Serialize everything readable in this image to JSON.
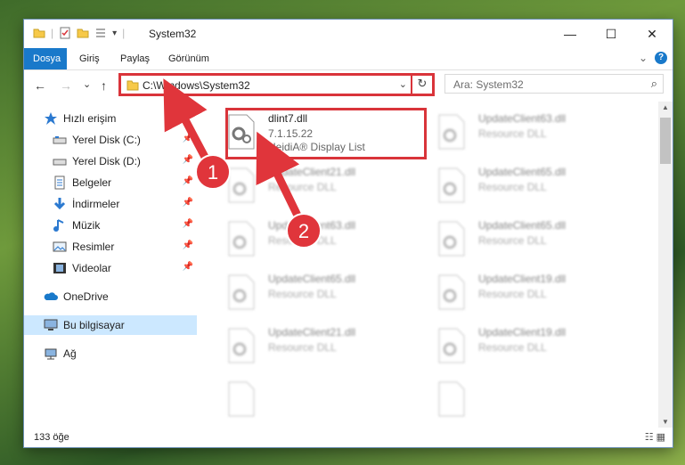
{
  "window": {
    "title": "System32",
    "min_glyph": "—",
    "max_glyph": "☐",
    "close_glyph": "✕"
  },
  "ribbon": {
    "tabs": [
      "Dosya",
      "Giriş",
      "Paylaş",
      "Görünüm"
    ],
    "expand_glyph": "⌄",
    "help_glyph": "?"
  },
  "nav": {
    "back": "←",
    "forward": "→",
    "recent": "⌄",
    "up": "↑",
    "address": "C:\\Windows\\System32",
    "dropdown": "⌄",
    "refresh": "↻",
    "search_placeholder": "Ara: System32",
    "search_icon": "⌕"
  },
  "sidebar": {
    "items": [
      {
        "label": "Hızlı erişim",
        "icon": "star-icon"
      },
      {
        "label": "Yerel Disk (C:)",
        "icon": "drive-icon",
        "pinned": true
      },
      {
        "label": "Yerel Disk (D:)",
        "icon": "drive-icon",
        "pinned": true
      },
      {
        "label": "Belgeler",
        "icon": "documents-icon",
        "pinned": true
      },
      {
        "label": "İndirmeler",
        "icon": "downloads-icon",
        "pinned": true
      },
      {
        "label": "Müzik",
        "icon": "music-icon",
        "pinned": true
      },
      {
        "label": "Resimler",
        "icon": "pictures-icon",
        "pinned": true
      },
      {
        "label": "Videolar",
        "icon": "videos-icon",
        "pinned": true
      },
      {
        "label": "OneDrive",
        "icon": "cloud-icon"
      },
      {
        "label": "Bu bilgisayar",
        "icon": "computer-icon",
        "selected": true
      },
      {
        "label": "Ağ",
        "icon": "network-icon"
      }
    ],
    "pin_glyph": "📌"
  },
  "files": {
    "highlighted": {
      "name": "dlint7.dll",
      "version": "7.1.15.22",
      "description": "HeidiA® Display List"
    },
    "others": [
      {
        "name": "UpdateClient63.dll",
        "type": "Resource DLL"
      },
      {
        "name": "UpdateClient21.dll",
        "type": "Resource DLL"
      },
      {
        "name": "UpdateClient65.dll",
        "type": "Resource DLL"
      },
      {
        "name": "UpdateClient63.dll",
        "type": "Resource DLL"
      },
      {
        "name": "UpdateClient65.dll",
        "type": "Resource DLL"
      },
      {
        "name": "UpdateClient65.dll",
        "type": "Resource DLL"
      },
      {
        "name": "UpdateClient19.dll",
        "type": "Resource DLL"
      },
      {
        "name": "UpdateClient21.dll",
        "type": "Resource DLL"
      },
      {
        "name": "UpdateClient19.dll",
        "type": "Resource DLL"
      }
    ]
  },
  "status": {
    "count": "133 öğe",
    "views": "☷ ▦"
  },
  "callouts": [
    {
      "number": "1"
    },
    {
      "number": "2"
    }
  ],
  "colors": {
    "accent": "#1979ca",
    "highlight": "#d9343a",
    "selected": "#cce8ff"
  }
}
